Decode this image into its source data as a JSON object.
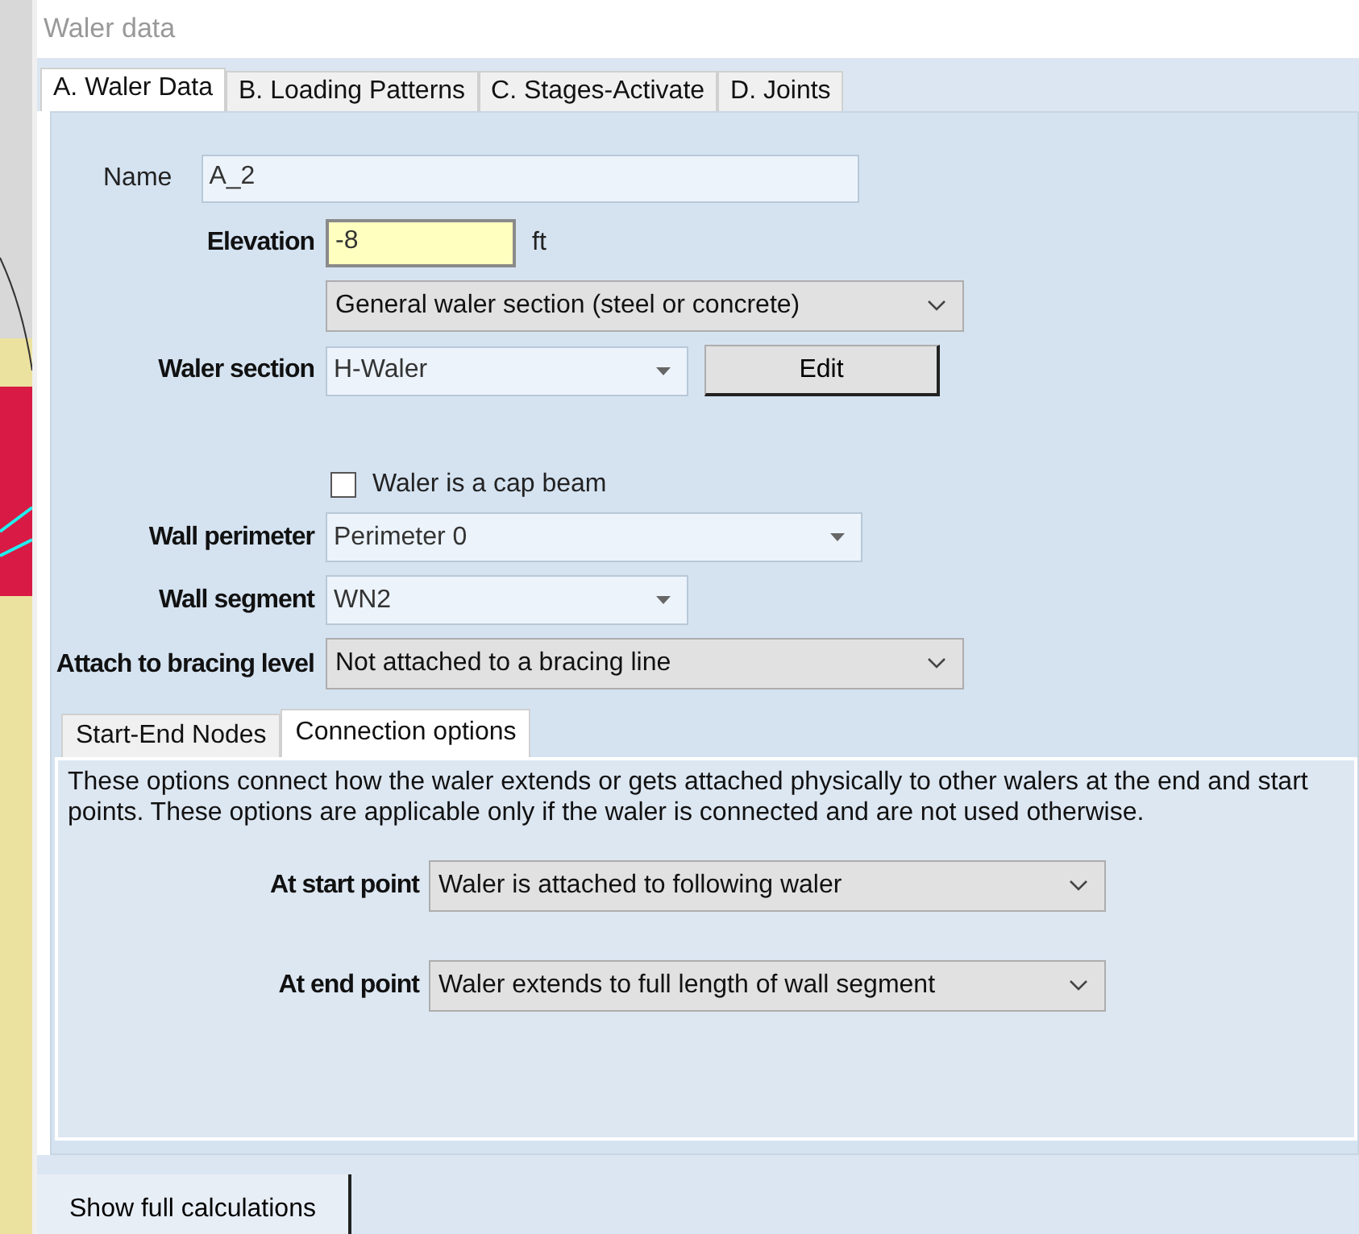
{
  "window": {
    "title": "Waler data"
  },
  "tabs": [
    {
      "label": "A. Waler Data",
      "selected": true
    },
    {
      "label": "B. Loading Patterns",
      "selected": false
    },
    {
      "label": "C. Stages-Activate",
      "selected": false
    },
    {
      "label": "D. Joints",
      "selected": false
    }
  ],
  "name_field": {
    "label": "Name",
    "value": "A_2"
  },
  "elevation": {
    "label": "Elevation",
    "value": "-8",
    "unit": "ft"
  },
  "section_type": {
    "value": "General waler section (steel or concrete)"
  },
  "waler_section": {
    "label": "Waler section",
    "value": "H-Waler",
    "button": "Edit"
  },
  "cap_beam": {
    "label": "Waler is a cap beam",
    "checked": false
  },
  "wall_perimeter": {
    "label": "Wall perimeter",
    "value": "Perimeter 0"
  },
  "wall_segment": {
    "label": "Wall segment",
    "value": "WN2"
  },
  "bracing": {
    "label": "Attach to bracing level",
    "value": "Not attached to a bracing line"
  },
  "sub_tabs": [
    {
      "label": "Start-End Nodes",
      "selected": false
    },
    {
      "label": "Connection options",
      "selected": true
    }
  ],
  "connection": {
    "description": "These options connect how the waler extends or gets attached physically to other walers at the end and start points. These options are applicable only if the waler is connected and are not used otherwise.",
    "options": [
      {
        "label": "At start point",
        "value": "Waler is attached to following waler"
      },
      {
        "label": "At end point",
        "value": "Waler extends to full length of wall segment"
      }
    ]
  },
  "footer_button": "Show full calculations"
}
